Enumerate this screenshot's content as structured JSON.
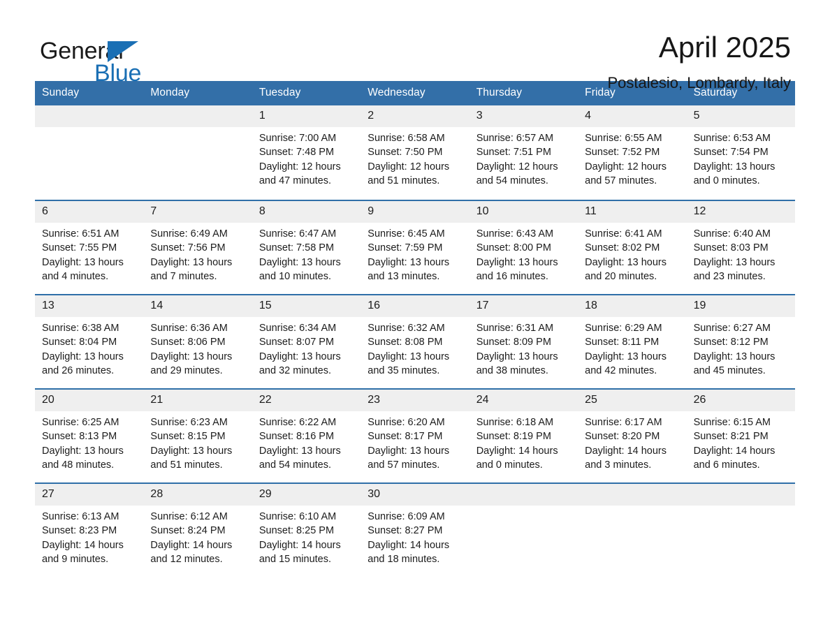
{
  "brand": {
    "name_part1": "General",
    "name_part2": "Blue",
    "logo_icon": "triangle-icon",
    "accent_color": "#1a6fb4"
  },
  "header": {
    "month_title": "April 2025",
    "location": "Postalesio, Lombardy, Italy"
  },
  "calendar": {
    "header_color": "#336fa8",
    "row_divider_color": "#2f6fa8",
    "daynum_band_color": "#efefef",
    "weekdays": [
      "Sunday",
      "Monday",
      "Tuesday",
      "Wednesday",
      "Thursday",
      "Friday",
      "Saturday"
    ],
    "weeks": [
      [
        {
          "day": "",
          "empty": true,
          "sunrise": "",
          "sunset": "",
          "daylight": ""
        },
        {
          "day": "",
          "empty": true,
          "sunrise": "",
          "sunset": "",
          "daylight": ""
        },
        {
          "day": "1",
          "sunrise": "Sunrise: 7:00 AM",
          "sunset": "Sunset: 7:48 PM",
          "daylight": "Daylight: 12 hours and 47 minutes."
        },
        {
          "day": "2",
          "sunrise": "Sunrise: 6:58 AM",
          "sunset": "Sunset: 7:50 PM",
          "daylight": "Daylight: 12 hours and 51 minutes."
        },
        {
          "day": "3",
          "sunrise": "Sunrise: 6:57 AM",
          "sunset": "Sunset: 7:51 PM",
          "daylight": "Daylight: 12 hours and 54 minutes."
        },
        {
          "day": "4",
          "sunrise": "Sunrise: 6:55 AM",
          "sunset": "Sunset: 7:52 PM",
          "daylight": "Daylight: 12 hours and 57 minutes."
        },
        {
          "day": "5",
          "sunrise": "Sunrise: 6:53 AM",
          "sunset": "Sunset: 7:54 PM",
          "daylight": "Daylight: 13 hours and 0 minutes."
        }
      ],
      [
        {
          "day": "6",
          "sunrise": "Sunrise: 6:51 AM",
          "sunset": "Sunset: 7:55 PM",
          "daylight": "Daylight: 13 hours and 4 minutes."
        },
        {
          "day": "7",
          "sunrise": "Sunrise: 6:49 AM",
          "sunset": "Sunset: 7:56 PM",
          "daylight": "Daylight: 13 hours and 7 minutes."
        },
        {
          "day": "8",
          "sunrise": "Sunrise: 6:47 AM",
          "sunset": "Sunset: 7:58 PM",
          "daylight": "Daylight: 13 hours and 10 minutes."
        },
        {
          "day": "9",
          "sunrise": "Sunrise: 6:45 AM",
          "sunset": "Sunset: 7:59 PM",
          "daylight": "Daylight: 13 hours and 13 minutes."
        },
        {
          "day": "10",
          "sunrise": "Sunrise: 6:43 AM",
          "sunset": "Sunset: 8:00 PM",
          "daylight": "Daylight: 13 hours and 16 minutes."
        },
        {
          "day": "11",
          "sunrise": "Sunrise: 6:41 AM",
          "sunset": "Sunset: 8:02 PM",
          "daylight": "Daylight: 13 hours and 20 minutes."
        },
        {
          "day": "12",
          "sunrise": "Sunrise: 6:40 AM",
          "sunset": "Sunset: 8:03 PM",
          "daylight": "Daylight: 13 hours and 23 minutes."
        }
      ],
      [
        {
          "day": "13",
          "sunrise": "Sunrise: 6:38 AM",
          "sunset": "Sunset: 8:04 PM",
          "daylight": "Daylight: 13 hours and 26 minutes."
        },
        {
          "day": "14",
          "sunrise": "Sunrise: 6:36 AM",
          "sunset": "Sunset: 8:06 PM",
          "daylight": "Daylight: 13 hours and 29 minutes."
        },
        {
          "day": "15",
          "sunrise": "Sunrise: 6:34 AM",
          "sunset": "Sunset: 8:07 PM",
          "daylight": "Daylight: 13 hours and 32 minutes."
        },
        {
          "day": "16",
          "sunrise": "Sunrise: 6:32 AM",
          "sunset": "Sunset: 8:08 PM",
          "daylight": "Daylight: 13 hours and 35 minutes."
        },
        {
          "day": "17",
          "sunrise": "Sunrise: 6:31 AM",
          "sunset": "Sunset: 8:09 PM",
          "daylight": "Daylight: 13 hours and 38 minutes."
        },
        {
          "day": "18",
          "sunrise": "Sunrise: 6:29 AM",
          "sunset": "Sunset: 8:11 PM",
          "daylight": "Daylight: 13 hours and 42 minutes."
        },
        {
          "day": "19",
          "sunrise": "Sunrise: 6:27 AM",
          "sunset": "Sunset: 8:12 PM",
          "daylight": "Daylight: 13 hours and 45 minutes."
        }
      ],
      [
        {
          "day": "20",
          "sunrise": "Sunrise: 6:25 AM",
          "sunset": "Sunset: 8:13 PM",
          "daylight": "Daylight: 13 hours and 48 minutes."
        },
        {
          "day": "21",
          "sunrise": "Sunrise: 6:23 AM",
          "sunset": "Sunset: 8:15 PM",
          "daylight": "Daylight: 13 hours and 51 minutes."
        },
        {
          "day": "22",
          "sunrise": "Sunrise: 6:22 AM",
          "sunset": "Sunset: 8:16 PM",
          "daylight": "Daylight: 13 hours and 54 minutes."
        },
        {
          "day": "23",
          "sunrise": "Sunrise: 6:20 AM",
          "sunset": "Sunset: 8:17 PM",
          "daylight": "Daylight: 13 hours and 57 minutes."
        },
        {
          "day": "24",
          "sunrise": "Sunrise: 6:18 AM",
          "sunset": "Sunset: 8:19 PM",
          "daylight": "Daylight: 14 hours and 0 minutes."
        },
        {
          "day": "25",
          "sunrise": "Sunrise: 6:17 AM",
          "sunset": "Sunset: 8:20 PM",
          "daylight": "Daylight: 14 hours and 3 minutes."
        },
        {
          "day": "26",
          "sunrise": "Sunrise: 6:15 AM",
          "sunset": "Sunset: 8:21 PM",
          "daylight": "Daylight: 14 hours and 6 minutes."
        }
      ],
      [
        {
          "day": "27",
          "sunrise": "Sunrise: 6:13 AM",
          "sunset": "Sunset: 8:23 PM",
          "daylight": "Daylight: 14 hours and 9 minutes."
        },
        {
          "day": "28",
          "sunrise": "Sunrise: 6:12 AM",
          "sunset": "Sunset: 8:24 PM",
          "daylight": "Daylight: 14 hours and 12 minutes."
        },
        {
          "day": "29",
          "sunrise": "Sunrise: 6:10 AM",
          "sunset": "Sunset: 8:25 PM",
          "daylight": "Daylight: 14 hours and 15 minutes."
        },
        {
          "day": "30",
          "sunrise": "Sunrise: 6:09 AM",
          "sunset": "Sunset: 8:27 PM",
          "daylight": "Daylight: 14 hours and 18 minutes."
        },
        {
          "day": "",
          "empty": true,
          "sunrise": "",
          "sunset": "",
          "daylight": ""
        },
        {
          "day": "",
          "empty": true,
          "sunrise": "",
          "sunset": "",
          "daylight": ""
        },
        {
          "day": "",
          "empty": true,
          "sunrise": "",
          "sunset": "",
          "daylight": ""
        }
      ]
    ]
  }
}
